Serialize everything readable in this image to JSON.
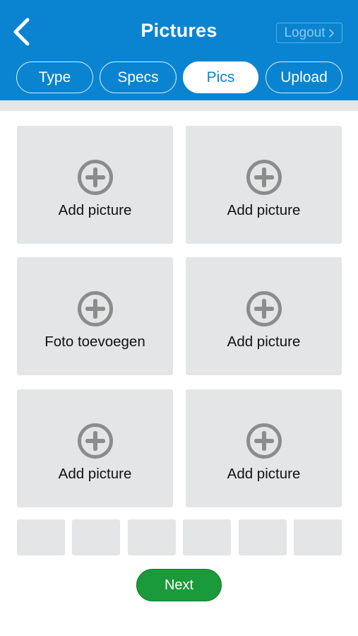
{
  "header": {
    "title": "Pictures",
    "back_icon": "chevron-left-icon",
    "logout_label": "Logout",
    "logout_icon": "chevron-right-icon",
    "background_color": "#0a84d0"
  },
  "tabs": [
    {
      "label": "Type",
      "active": false
    },
    {
      "label": "Specs",
      "active": false
    },
    {
      "label": "Pics",
      "active": true
    },
    {
      "label": "Upload",
      "active": false
    }
  ],
  "picture_slots": [
    {
      "label": "Add picture",
      "icon": "plus-circle-icon"
    },
    {
      "label": "Add picture",
      "icon": "plus-circle-icon"
    },
    {
      "label": "Foto toevoegen",
      "icon": "plus-circle-icon"
    },
    {
      "label": "Add picture",
      "icon": "plus-circle-icon"
    },
    {
      "label": "Add picture",
      "icon": "plus-circle-icon"
    },
    {
      "label": "Add picture",
      "icon": "plus-circle-icon"
    }
  ],
  "thumbnail_count": 6,
  "next_label": "Next",
  "next_color": "#1a9a3a"
}
